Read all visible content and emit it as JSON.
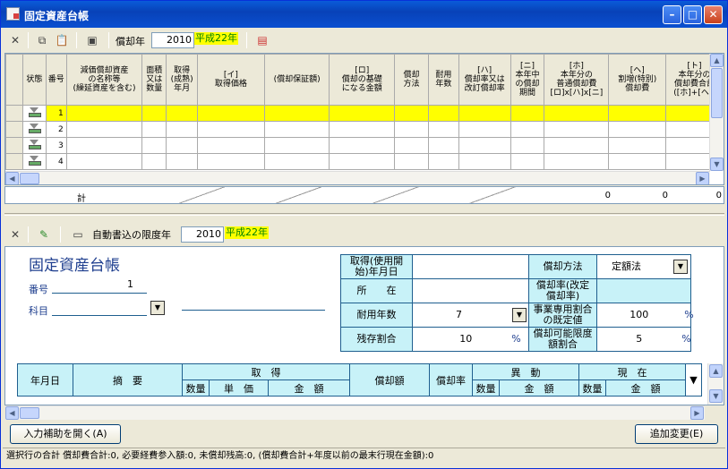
{
  "window": {
    "title": "固定資産台帳",
    "min": "–",
    "max": "□",
    "close": "✕"
  },
  "top_toolbar": {
    "depr_year_label": "償却年",
    "depr_year": "2010",
    "era": "平成22年"
  },
  "grid": {
    "columns": [
      "状態",
      "番号",
      "減価償却資産\nの名称等\n(繰延資産を含む)",
      "面積\n又は\n数量",
      "取得\n(成熟)\n年月",
      "[イ]\n取得価格",
      "(償却保証額)",
      "[ロ]\n償却の基礎\nになる金額",
      "償却\n方法",
      "耐用\n年数",
      "[ハ]\n償却率又は\n改訂償却率",
      "[ニ]\n本年中\nの償却\n期間",
      "[ホ]\n本年分の\n普通償却費\n[ロ]x[ハ]x[ニ]",
      "[ヘ]\n割増(特別)\n償却費",
      "[ト]\n本年分の\n償却費合計\n([ホ]+[ヘ])"
    ],
    "rows": [
      {
        "no": "1"
      },
      {
        "no": "2"
      },
      {
        "no": "3"
      },
      {
        "no": "4"
      }
    ],
    "total_label": "計",
    "total_values": [
      "0",
      "0",
      "0"
    ]
  },
  "lower_toolbar": {
    "limit_label": "自動書込の限度年",
    "limit_year": "2010",
    "era": "平成22年"
  },
  "form": {
    "title": "固定資産台帳",
    "number_label": "番号",
    "number_value": "1",
    "subject_label": "科目",
    "acq_date_label": "取得(使用開\n始)年月日",
    "location_label": "所　　在",
    "useful_life_label": "耐用年数",
    "useful_life_value": "7",
    "residual_label": "残存割合",
    "residual_value": "10",
    "pct": "%",
    "depr_method_label": "償却方法",
    "depr_method_value": "定額法",
    "depr_rate_label": "償却率(改定\n償却率)",
    "business_ratio_label": "事業専用割合\nの既定値",
    "business_ratio_value": "100",
    "depr_limit_label": "償却可能限度\n額割合",
    "depr_limit_value": "5"
  },
  "ledger": {
    "date": "年月日",
    "summary": "摘　要",
    "acquisition": "取　得",
    "qty": "数量",
    "unit_price": "単　価",
    "amount": "金　額",
    "depreciation": "償却額",
    "rate": "償却率",
    "change": "異　動",
    "current": "現　在",
    "mark": "▼"
  },
  "buttons": {
    "assist": "入力補助を開く(A)",
    "add_change": "追加変更(E)"
  },
  "status": "選択行の合計 償却費合計:0, 必要経費参入額:0, 未償却残高:0, (償却費合計+年度以前の最末行現在金額):0"
}
